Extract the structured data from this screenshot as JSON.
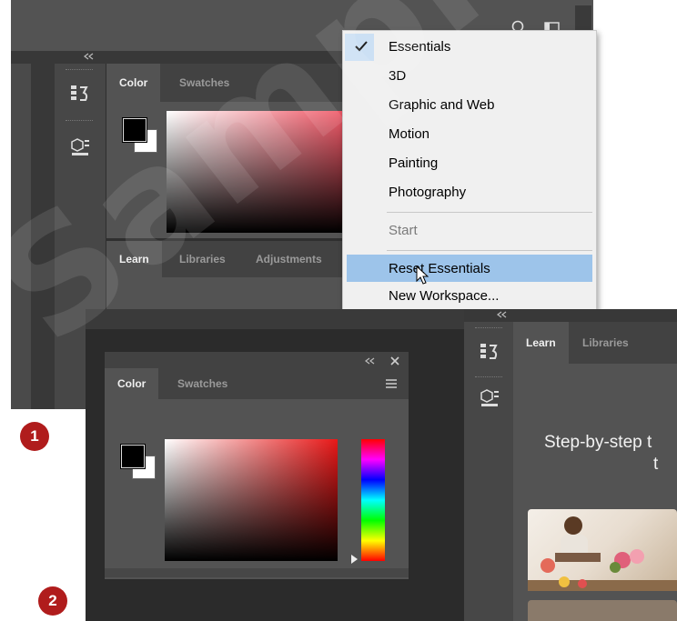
{
  "screenshot1": {
    "color_panel": {
      "tabs": [
        {
          "label": "Color"
        },
        {
          "label": "Swatches"
        }
      ]
    },
    "learn_panel": {
      "tabs": [
        {
          "label": "Learn"
        },
        {
          "label": "Libraries"
        },
        {
          "label": "Adjustments"
        }
      ]
    },
    "workspace_menu": {
      "items": [
        {
          "label": "Essentials",
          "checked": true
        },
        {
          "label": "3D"
        },
        {
          "label": "Graphic and Web"
        },
        {
          "label": "Motion"
        },
        {
          "label": "Painting"
        },
        {
          "label": "Photography"
        },
        {
          "label": "Start",
          "disabled": true
        },
        {
          "label": "Reset Essentials",
          "highlighted": true
        },
        {
          "label": "New Workspace..."
        }
      ]
    }
  },
  "screenshot2": {
    "floating_color_panel": {
      "tabs": [
        {
          "label": "Color"
        },
        {
          "label": "Swatches"
        }
      ]
    },
    "learn_panel": {
      "tabs": [
        {
          "label": "Learn"
        },
        {
          "label": "Libraries"
        }
      ],
      "heading_line1": "Step-by-step t",
      "heading_line2": "t"
    }
  },
  "badges": [
    {
      "label": "1"
    },
    {
      "label": "2"
    }
  ],
  "watermark_text": "Sample",
  "colors": {
    "menu_highlight": "#9dc4ea",
    "badge": "#b01c1c",
    "panel_dark": "#383838",
    "panel": "#535353"
  }
}
